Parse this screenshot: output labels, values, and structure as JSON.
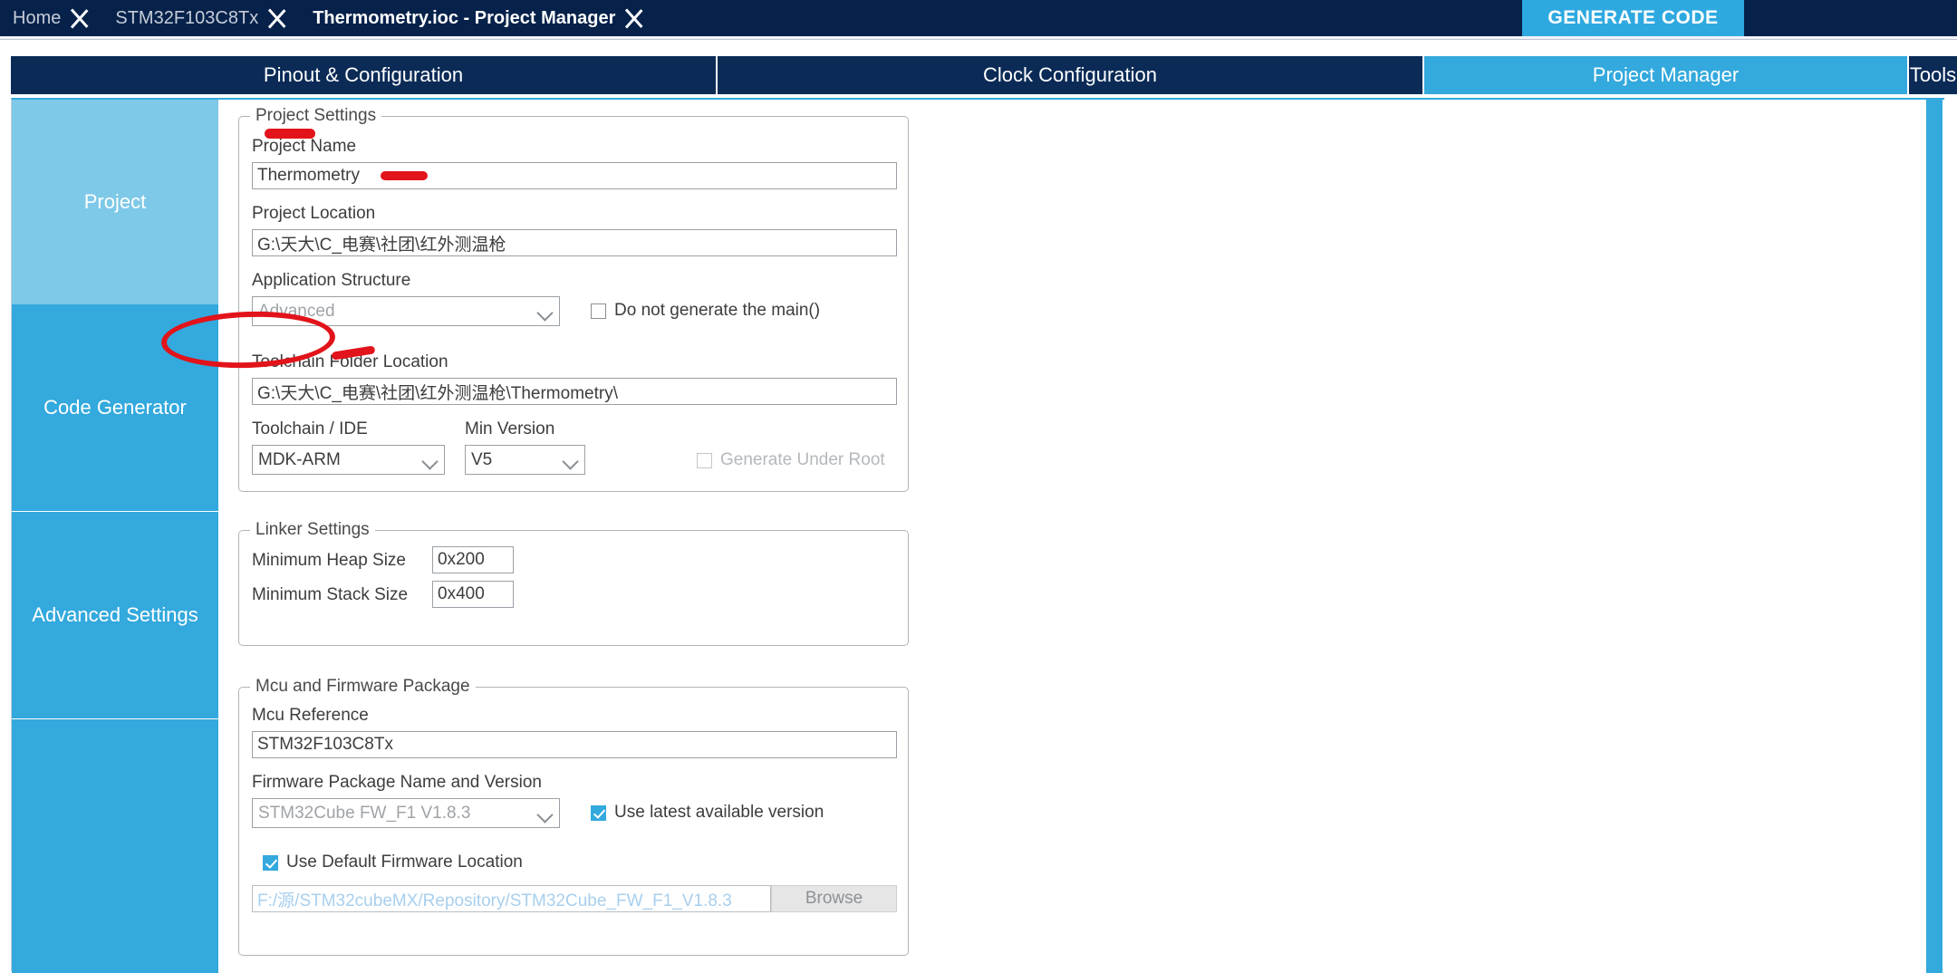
{
  "breadcrumb": {
    "items": [
      {
        "label": "Home",
        "active": false
      },
      {
        "label": "STM32F103C8Tx",
        "active": false
      },
      {
        "label": "Thermometry.ioc - Project Manager",
        "active": true
      }
    ]
  },
  "header": {
    "generate_code_label": "GENERATE CODE"
  },
  "tabs": [
    {
      "label": "Pinout & Configuration",
      "active": false
    },
    {
      "label": "Clock Configuration",
      "active": false
    },
    {
      "label": "Project Manager",
      "active": true
    },
    {
      "label": "Tools",
      "active": false
    }
  ],
  "sidebar": {
    "items": [
      {
        "label": "Project",
        "selected": true
      },
      {
        "label": "Code Generator",
        "selected": false
      },
      {
        "label": "Advanced Settings",
        "selected": false
      },
      {
        "label": "",
        "selected": false
      }
    ]
  },
  "project_settings": {
    "group_title": "Project Settings",
    "project_name_label": "Project Name",
    "project_name_value": "Thermometry",
    "project_location_label": "Project Location",
    "project_location_value": "G:\\天大\\C_电赛\\社团\\红外测温枪",
    "application_structure_label": "Application Structure",
    "application_structure_value": "Advanced",
    "do_not_generate_main_label": "Do not generate the main()",
    "do_not_generate_main_checked": false,
    "toolchain_folder_label": "Toolchain Folder Location",
    "toolchain_folder_value": "G:\\天大\\C_电赛\\社团\\红外测温枪\\Thermometry\\",
    "toolchain_ide_label": "Toolchain / IDE",
    "toolchain_ide_value": "MDK-ARM",
    "min_version_label": "Min Version",
    "min_version_value": "V5",
    "generate_under_root_label": "Generate Under Root",
    "generate_under_root_checked": false
  },
  "linker_settings": {
    "group_title": "Linker Settings",
    "min_heap_label": "Minimum Heap Size",
    "min_heap_value": "0x200",
    "min_stack_label": "Minimum Stack Size",
    "min_stack_value": "0x400"
  },
  "mcu_firmware": {
    "group_title": "Mcu and Firmware Package",
    "mcu_reference_label": "Mcu Reference",
    "mcu_reference_value": "STM32F103C8Tx",
    "firmware_package_label": "Firmware Package Name and Version",
    "firmware_package_value": "STM32Cube FW_F1 V1.8.3",
    "use_latest_label": "Use latest available version",
    "use_latest_checked": true,
    "use_default_location_label": "Use Default Firmware Location",
    "use_default_location_checked": true,
    "firmware_path_value": "F:/源/STM32cubeMX/Repository/STM32Cube_FW_F1_V1.8.3",
    "browse_label": "Browse"
  },
  "colors": {
    "navy": "#06214a",
    "tab_navy": "#0b2b56",
    "accent_blue": "#33a9dd",
    "selected_sidebar": "#7ec8e8",
    "annotation_red": "#e2131a"
  }
}
